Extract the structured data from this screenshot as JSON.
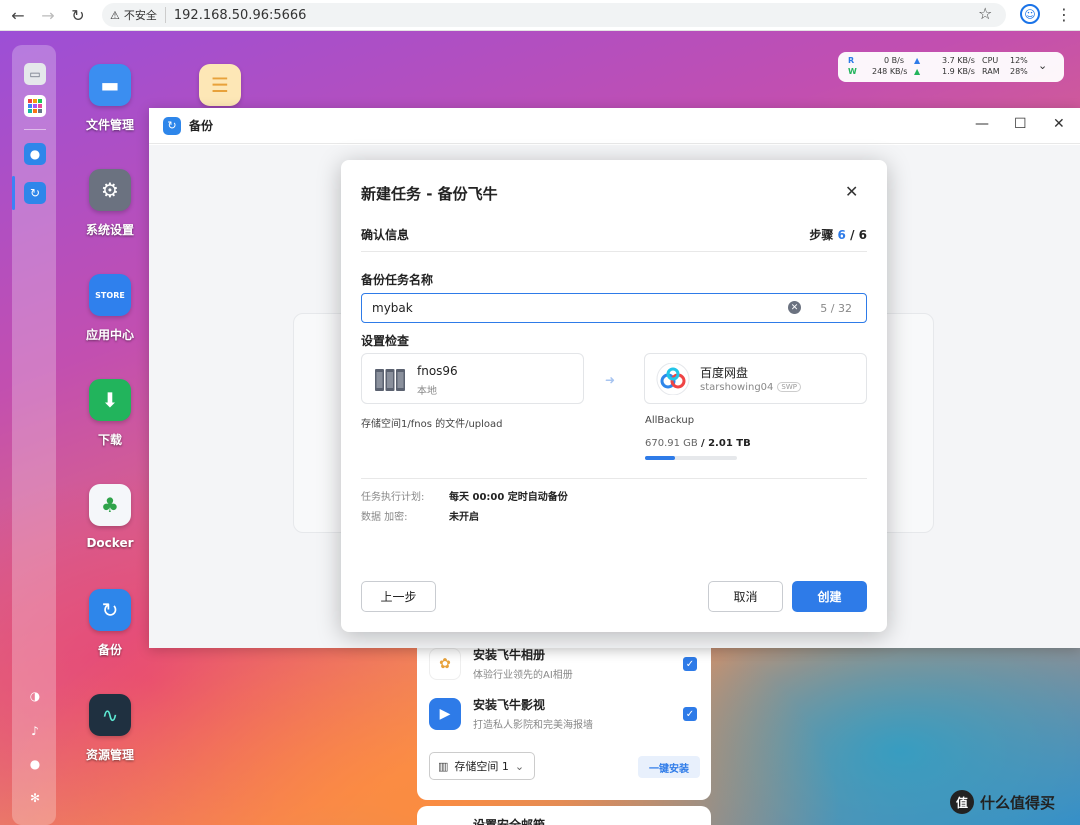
{
  "browser": {
    "back_icon": "←",
    "forward_icon": "→",
    "reload_icon": "↻",
    "insecure_icon": "⚠",
    "insecure_label": "不安全",
    "url": "192.168.50.96:5666",
    "star_icon": "☆",
    "profile_icon": "☺",
    "menu_icon": "⋮"
  },
  "desktop_apps": [
    {
      "label": "文件管理",
      "color": "#3b8ef0"
    },
    {
      "label": "系统设置",
      "color": "#6b7280"
    },
    {
      "label": "应用中心",
      "color": "#2f80ed"
    },
    {
      "label": "下载",
      "color": "#22b45c"
    },
    {
      "label": "Docker",
      "color": "#f5f7fa"
    },
    {
      "label": "备份",
      "color": "#2e86ea"
    },
    {
      "label": "资源管理",
      "color": "#1f3040"
    }
  ],
  "sysmon": {
    "r_label": "R",
    "w_label": "W",
    "r_speed": "0  B/s",
    "w_speed": "248 KB/s",
    "up_label": "3.7 KB/s",
    "down_label": "1.9 KB/s",
    "cpu_label": "CPU",
    "ram_label": "RAM",
    "cpu_value": "12%",
    "ram_value": "28%"
  },
  "window": {
    "title": "备份",
    "minimize": "—",
    "maximize": "☐",
    "close": "✕"
  },
  "modal": {
    "title": "新建任务 - 备份飞牛",
    "close": "✕",
    "section": "确认信息",
    "step_prefix": "步骤",
    "step_current": "6",
    "step_sep": "/",
    "step_total": "6",
    "name_label": "备份任务名称",
    "name_value": "mybak",
    "name_count": "5 / 32",
    "check_label": "设置检查",
    "source": {
      "name": "fnos96",
      "sub": "本地",
      "path": "存储空间1/fnos 的文件/upload"
    },
    "target": {
      "name": "百度网盘",
      "account": "starshowing04",
      "badge": "SWP",
      "path": "AllBackup",
      "used": "670.91 GB",
      "total": "/ 2.01 TB",
      "usage_fraction": 0.33
    },
    "schedule_key": "任务执行计划:",
    "schedule_value": "每天 00:00 定时自动备份",
    "encrypt_key": "数据 加密:",
    "encrypt_value": "未开启",
    "prev_button": "上一步",
    "cancel_button": "取消",
    "create_button": "创建"
  },
  "under_panel": {
    "row1_title": "安装飞牛相册",
    "row1_sub": "体验行业领先的AI相册",
    "row2_title": "安装飞牛影视",
    "row2_sub": "打造私人影院和完美海报墙",
    "storage_select": "存储空间 1",
    "install_button": "一键安装",
    "next_title": "设置安全邮箱"
  },
  "watermark": "什么值得买"
}
